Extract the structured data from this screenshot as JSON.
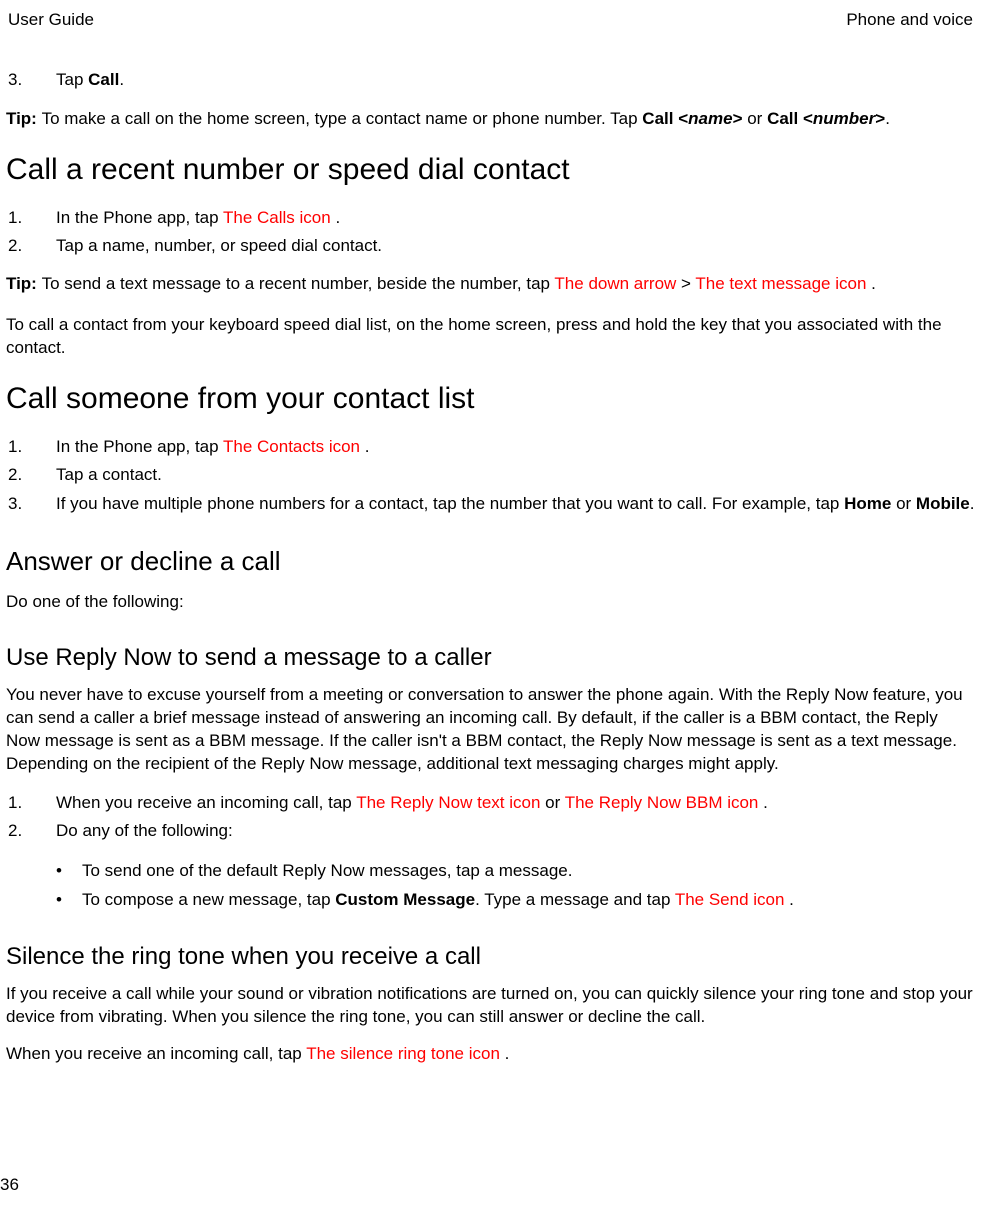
{
  "header": {
    "left": "User Guide",
    "right": "Phone and voice"
  },
  "step3": {
    "num": "3.",
    "pre": "Tap ",
    "bold": "Call",
    "post": "."
  },
  "tip1": {
    "label": "Tip: ",
    "t1": "To make a call on the home screen, type a contact name or phone number. Tap ",
    "b1": "Call <",
    "i1": "name",
    "b2": ">",
    "t2": " or ",
    "b3": "Call <",
    "i2": "number",
    "b4": ">",
    "t3": "."
  },
  "h1a": "Call a recent number or speed dial contact",
  "listA": {
    "i1num": "1.",
    "i1pre": "In the Phone app, tap ",
    "i1icon": " The Calls icon ",
    "i1post": ".",
    "i2num": "2.",
    "i2text": "Tap a name, number, or speed dial contact."
  },
  "tip2": {
    "label": "Tip: ",
    "t1": "To send a text message to a recent number, beside the number, tap ",
    "icon1": " The down arrow ",
    "gt": " > ",
    "icon2": " The text message icon ",
    "t2": "."
  },
  "paraA": "To call a contact from your keyboard speed dial list, on the home screen, press and hold the key that you associated with the contact.",
  "h1b": "Call someone from your contact list",
  "listB": {
    "i1num": "1.",
    "i1pre": "In the Phone app, tap ",
    "i1icon": " The Contacts icon ",
    "i1post": ".",
    "i2num": "2.",
    "i2text": "Tap a contact.",
    "i3num": "3.",
    "i3pre": "If you have multiple phone numbers for a contact, tap the number that you want to call. For example, tap ",
    "i3b1": "Home",
    "i3mid": " or ",
    "i3b2": "Mobile",
    "i3post": "."
  },
  "h2a": "Answer or decline a call",
  "paraB": "Do one of the following:",
  "h3a": "Use Reply Now to send a message to a caller",
  "paraC": "You never have to excuse yourself from a meeting or conversation to answer the phone again. With the Reply Now feature, you can send a caller a brief message instead of answering an incoming call. By default, if the caller is a BBM contact, the Reply Now message is sent as a BBM message. If the caller isn't a BBM contact, the Reply Now message is sent as a text message. Depending on the recipient of the Reply Now message, additional text messaging charges might apply.",
  "listC": {
    "i1num": "1.",
    "i1pre": "When you receive an incoming call, tap ",
    "i1icon1": " The Reply Now text icon ",
    "i1mid": " or ",
    "i1icon2": " The Reply Now BBM icon ",
    "i1post": ".",
    "i2num": "2.",
    "i2text": "Do any of the following:"
  },
  "bullets": {
    "b1": " To send one of the default Reply Now messages, tap a message.",
    "b2pre": "To compose a new message, tap ",
    "b2bold": "Custom Message",
    "b2mid": ". Type a message and tap ",
    "b2icon": " The Send icon ",
    "b2post": "."
  },
  "h3b": "Silence the ring tone when you receive a call",
  "paraD": "If you receive a call while your sound or vibration notifications are turned on, you can quickly silence your ring tone and stop your device from vibrating. When you silence the ring tone, you can still answer or decline the call.",
  "paraE": {
    "pre": "When you receive an incoming call, tap ",
    "icon": " The silence ring tone icon ",
    "post": "."
  },
  "pageNumber": "36",
  "bulletChar": "•"
}
